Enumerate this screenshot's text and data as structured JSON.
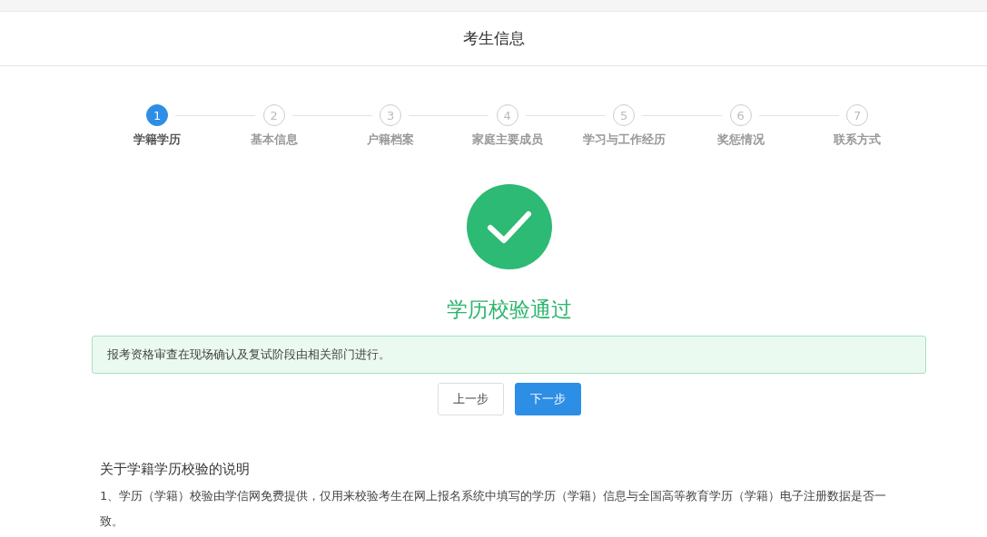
{
  "header": {
    "title": "考生信息"
  },
  "steps": [
    {
      "number": "1",
      "label": "学籍学历",
      "selected": true
    },
    {
      "number": "2",
      "label": "基本信息",
      "selected": false
    },
    {
      "number": "3",
      "label": "户籍档案",
      "selected": false
    },
    {
      "number": "4",
      "label": "家庭主要成员",
      "selected": false
    },
    {
      "number": "5",
      "label": "学习与工作经历",
      "selected": false
    },
    {
      "number": "6",
      "label": "奖惩情况",
      "selected": false
    },
    {
      "number": "7",
      "label": "联系方式",
      "selected": false
    }
  ],
  "result": {
    "title": "学历校验通过"
  },
  "alert": {
    "text": "报考资格审查在现场确认及复试阶段由相关部门进行。"
  },
  "buttons": [
    {
      "label": "上一步",
      "kind": "default"
    },
    {
      "label": "下一步",
      "kind": "primary"
    }
  ],
  "notes": {
    "title": "关于学籍学历校验的说明",
    "paragraphs": [
      "1、学历（学籍）校验由学信网免费提供，仅用来校验考生在网上报名系统中填写的学历（学籍）信息与全国高等教育学历（学籍）电子注册数据是否一致。"
    ]
  }
}
